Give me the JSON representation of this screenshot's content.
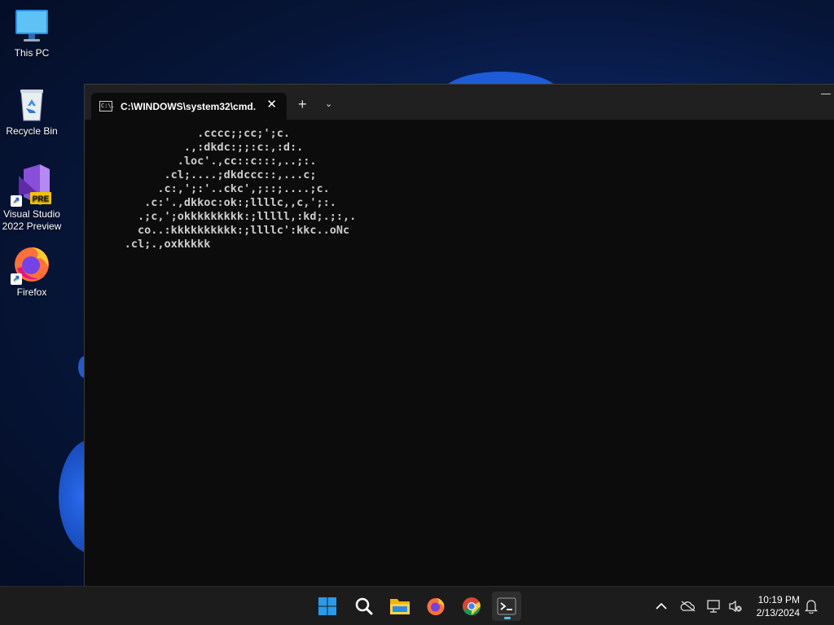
{
  "desktop": {
    "icons": [
      {
        "label": "This PC",
        "icon": "monitor-icon"
      },
      {
        "label": "Recycle Bin",
        "icon": "recycle-bin-icon"
      },
      {
        "label": "Visual Studio 2022 Preview",
        "icon": "visual-studio-icon",
        "badge": "PRE"
      },
      {
        "label": "Firefox",
        "icon": "firefox-icon"
      }
    ]
  },
  "terminal": {
    "tab_title": "C:\\WINDOWS\\system32\\cmd.",
    "tab_icon_text": "C:\\.",
    "close_glyph": "✕",
    "new_tab_glyph": "+",
    "dropdown_glyph": "⌄",
    "lines": [
      "                 .cccc;;cc;';c.",
      "               .,:dkdc:;;:c:,:d:.",
      "              .loc'.,cc::c:::,..;:.",
      "            .cl;....;dkdccc::,...c;",
      "           .c:,';:'..ckc',;::;....;c.",
      "         .c:'.,dkkoc:ok:;llllc,,c,';:.",
      "        .;c,';okkkkkkkkk:;lllll,:kd;.;:,.",
      "        co..:kkkkkkkkkk:;llllc':kkc..oNc",
      "      .cl;.,oxkkkkk"
    ]
  },
  "taskbar": {
    "apps": [
      "start-icon",
      "search-icon",
      "file-explorer-icon",
      "firefox-icon",
      "chrome-icon",
      "terminal-icon"
    ],
    "active_app": "terminal-icon",
    "tray": [
      "chevron-up-icon",
      "onedrive-icon",
      "network-icon",
      "volume-muted-icon",
      "notification-bell-icon"
    ],
    "time": "10:19 PM",
    "date": "2/13/2024"
  },
  "colors": {
    "accent": "#4cc2ff",
    "console_bg": "#0c0c0c",
    "console_fg": "#cccccc",
    "titlebar_bg": "#202020",
    "taskbar_bg": "#1c1c1c"
  }
}
